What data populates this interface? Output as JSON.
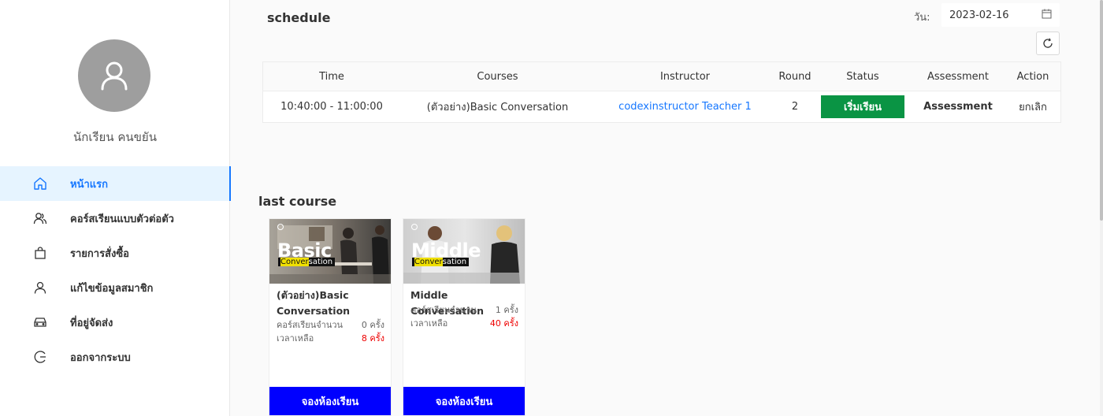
{
  "user": {
    "name": "นักเรียน คนขยัน"
  },
  "sidebar": {
    "items": [
      {
        "label": "หน้าแรก",
        "icon": "home-icon",
        "active": true
      },
      {
        "label": "คอร์สเรียนแบบตัวต่อตัว",
        "icon": "users-icon"
      },
      {
        "label": "รายการสั่งซื้อ",
        "icon": "shopping-bag-icon"
      },
      {
        "label": "แก้ไขข้อมูลสมาชิก",
        "icon": "user-icon"
      },
      {
        "label": "ที่อยู่จัดส่ง",
        "icon": "car-icon"
      },
      {
        "label": "ออกจากระบบ",
        "icon": "logout-icon"
      }
    ]
  },
  "schedule": {
    "title": "schedule",
    "date_label": "วัน:",
    "date_value": "2023-02-16",
    "columns": [
      "Time",
      "Courses",
      "Instructor",
      "Round",
      "Status",
      "Assessment",
      "Action"
    ],
    "rows": [
      {
        "time": "10:40:00 - 11:00:00",
        "course": "(ตัวอย่าง)Basic Conversation",
        "instructor": "codexinstructor Teacher 1",
        "round": "2",
        "status": "เริ่มเรียน",
        "assessment": "Assessment",
        "action": "ยกเลิก"
      }
    ]
  },
  "last_course": {
    "title": "last course",
    "cards": [
      {
        "image_title": "Basic",
        "image_subtitle_highlight": "Conver",
        "image_subtitle_rest": "sation",
        "name": "(ตัวอย่าง)Basic Conversation",
        "count_label": "คอร์สเรียนจำนวน",
        "count_value": "0 ครั้ง",
        "remain_label": "เวลาเหลือ",
        "remain_value": "8 ครั้ง",
        "button": "จองห้องเรียน"
      },
      {
        "image_title": "Middle",
        "image_subtitle_highlight": "Conver",
        "image_subtitle_rest": "sation",
        "name": "Middle Conversation",
        "count_label": "คอร์สเรียนจำนวน",
        "count_value": "1 ครั้ง",
        "remain_label": "เวลาเหลือ",
        "remain_value": "40 ครั้ง",
        "button": "จองห้องเรียน"
      }
    ]
  },
  "colors": {
    "accent": "#1677ff",
    "status_green": "#0a9444",
    "book_blue": "#0000ff",
    "remain_red": "#ee0000"
  }
}
